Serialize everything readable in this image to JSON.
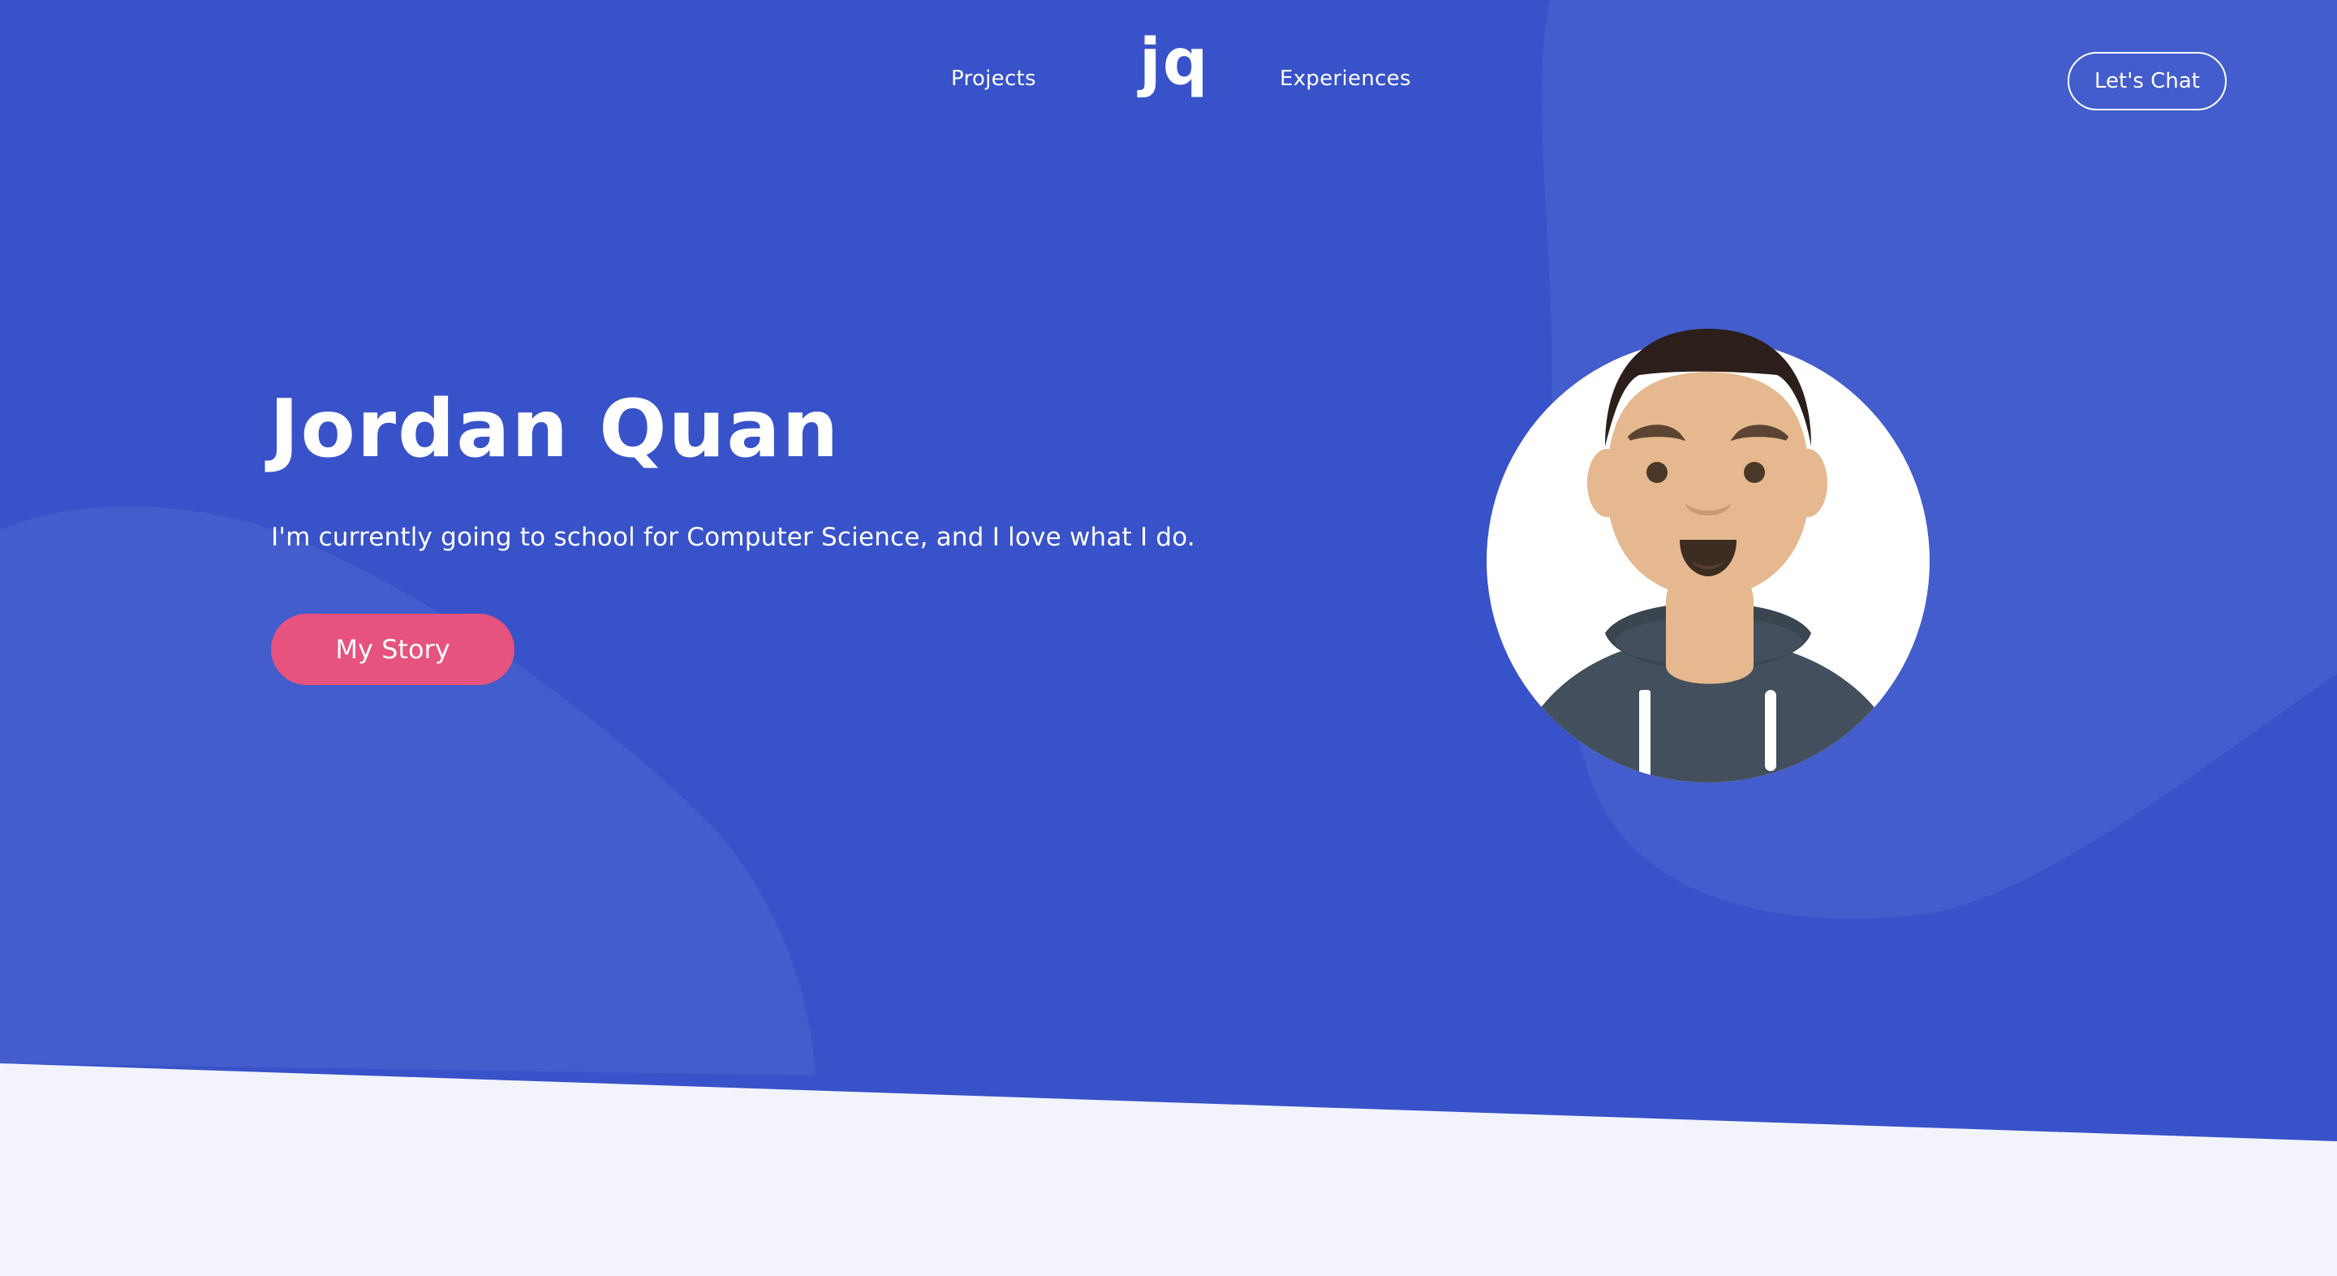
{
  "nav": {
    "projects_label": "Projects",
    "logo_text": "jq",
    "experiences_label": "Experiences",
    "chat_label": "Let's Chat"
  },
  "hero": {
    "name": "Jordan Quan",
    "subtitle": "I'm currently going to school for Computer Science, and I love what I do.",
    "cta_label": "My Story"
  },
  "colors": {
    "hero_background": "#3852c9",
    "blob": "#435dcc",
    "cta": "#e5537e",
    "section_background": "#f3f3fb"
  },
  "icons": {
    "avatar": "avatar-illustration"
  }
}
